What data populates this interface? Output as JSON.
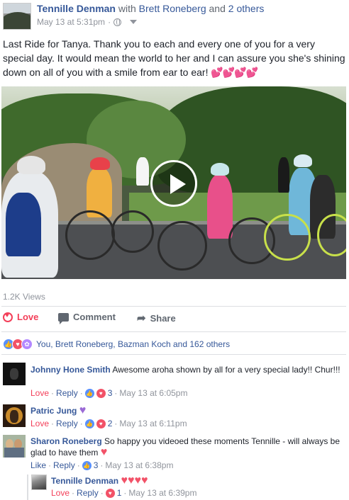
{
  "post": {
    "author": "Tennille Denman",
    "with_text": "with",
    "tagged_1": "Brett Roneberg",
    "and_text": "and",
    "tagged_others": "2 others",
    "timestamp": "May 13 at 5:31pm",
    "sep": "·",
    "text": "Last Ride for Tanya. Thank you to each and every one of you for a very special day. It would mean the world to her and I can assure you she's shining down on all of you with a smile from ear to ear!",
    "text_hearts": "💕💕💕💕"
  },
  "video": {
    "views": "1.2K Views"
  },
  "actions": {
    "love_label": "Love",
    "comment_label": "Comment",
    "share_label": "Share"
  },
  "reactions": {
    "summary": "You, Brett Roneberg, Bazman Koch and 162 others"
  },
  "comments": [
    {
      "name": "Johnny Hone Smith",
      "text": "Awesome aroha shown by all for a very special lady!! Chur!!!",
      "action_1": "Love",
      "action_2": "Reply",
      "count": "3",
      "time": "May 13 at 6:05pm",
      "sep": "·"
    },
    {
      "name": "Patric Jung",
      "text": "",
      "action_1": "Love",
      "action_2": "Reply",
      "count": "2",
      "time": "May 13 at 6:11pm",
      "sep": "·"
    },
    {
      "name": "Sharon Roneberg",
      "text": "So happy you videoed these moments Tennille - will always be glad to have them",
      "action_1": "Like",
      "action_2": "Reply",
      "count": "3",
      "time": "May 13 at 6:38pm",
      "sep": "·"
    },
    {
      "name": "Tennille Denman",
      "text": "",
      "action_1": "Love",
      "action_2": "Reply",
      "count": "1",
      "time": "May 13 at 6:39pm",
      "sep": "·"
    }
  ],
  "colors": {
    "link_blue": "#365899",
    "love_red": "#f33e58",
    "meta_gray": "#90949c"
  },
  "icons": [
    "globe-icon",
    "chevron-down-icon",
    "play-icon",
    "heart-outline-icon",
    "comment-icon",
    "share-icon",
    "like-reaction-icon",
    "love-reaction-icon",
    "wow-reaction-icon"
  ]
}
